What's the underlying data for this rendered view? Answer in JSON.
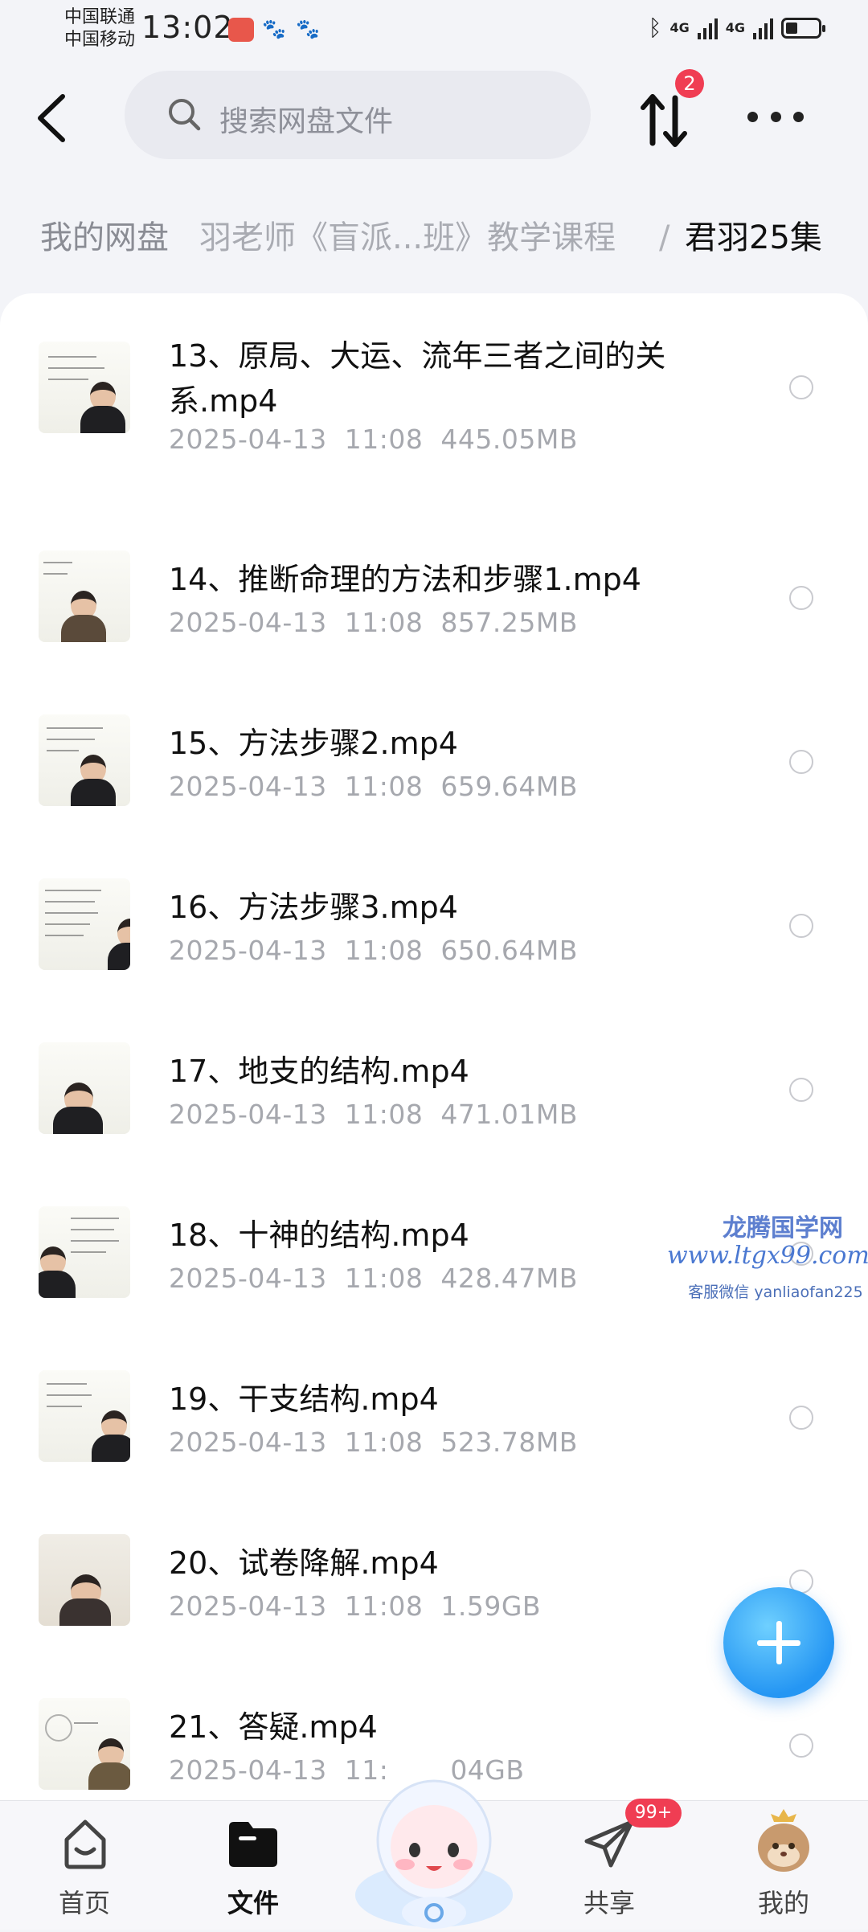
{
  "status_bar": {
    "carrier1": "中国联通",
    "carrier2": "中国移动",
    "time": "13:02",
    "net1": "4G",
    "net2": "4G"
  },
  "header": {
    "search_placeholder": "搜索网盘文件",
    "transfer_badge": "2"
  },
  "breadcrumb": {
    "home": "我的网盘",
    "middle": "羽老师《盲派...班》教学课程",
    "separator": "/",
    "current": "君羽25集"
  },
  "files": [
    {
      "name": "13、原局、大运、流年三者之间的关系.mp4",
      "date": "2025-04-13",
      "time": "11:08",
      "size": "445.05MB"
    },
    {
      "name": "14、推断命理的方法和步骤1.mp4",
      "date": "2025-04-13",
      "time": "11:08",
      "size": "857.25MB"
    },
    {
      "name": "15、方法步骤2.mp4",
      "date": "2025-04-13",
      "time": "11:08",
      "size": "659.64MB"
    },
    {
      "name": "16、方法步骤3.mp4",
      "date": "2025-04-13",
      "time": "11:08",
      "size": "650.64MB"
    },
    {
      "name": "17、地支的结构.mp4",
      "date": "2025-04-13",
      "time": "11:08",
      "size": "471.01MB"
    },
    {
      "name": "18、十神的结构.mp4",
      "date": "2025-04-13",
      "time": "11:08",
      "size": "428.47MB"
    },
    {
      "name": "19、干支结构.mp4",
      "date": "2025-04-13",
      "time": "11:08",
      "size": "523.78MB"
    },
    {
      "name": "20、试卷降解.mp4",
      "date": "2025-04-13",
      "time": "11:08",
      "size": "1.59GB"
    },
    {
      "name": "21、答疑.mp4",
      "date": "2025-04-13",
      "time": "11:",
      "size": "04GB"
    }
  ],
  "watermark": {
    "line1": "龙腾国学网",
    "line2": "www.ltgx99.com",
    "line3": "客服微信 yanliaofan225"
  },
  "nav": {
    "home": "首页",
    "files": "文件",
    "share": "共享",
    "mine": "我的",
    "share_badge": "99+"
  },
  "colors": {
    "accent": "#2596f3",
    "badge": "#f03d53",
    "meta_text": "#a6a8ae"
  }
}
